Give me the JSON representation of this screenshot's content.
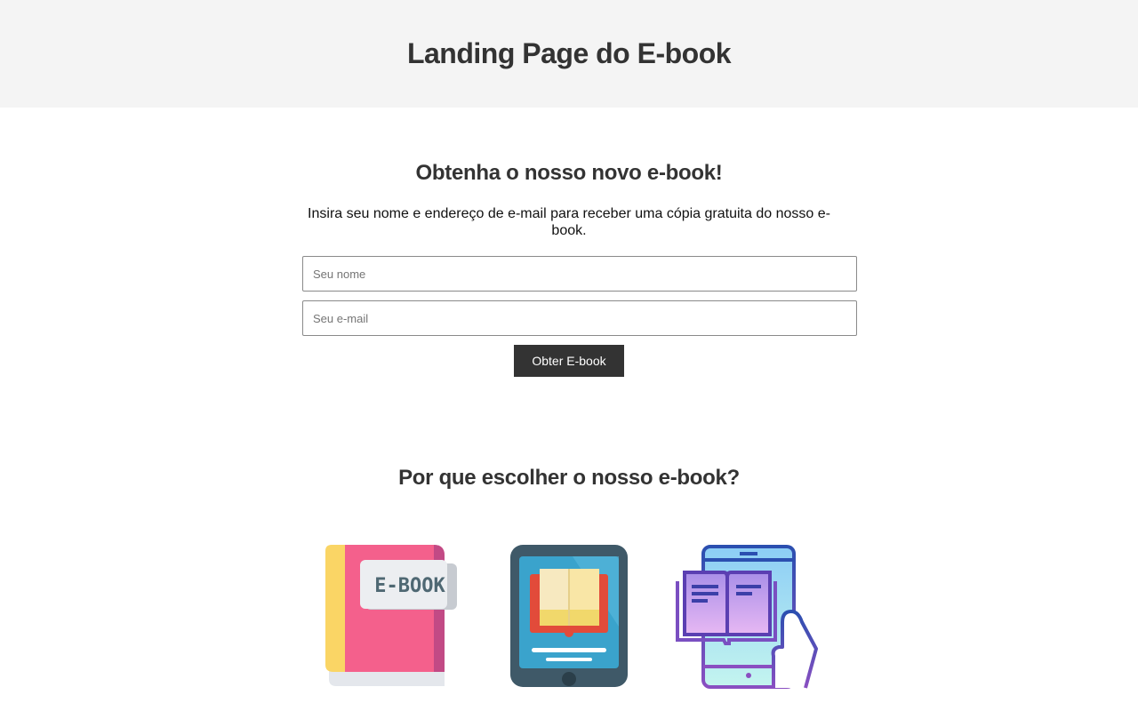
{
  "header": {
    "title": "Landing Page do E-book"
  },
  "signup": {
    "title": "Obtenha o nosso novo e-book!",
    "description": "Insira seu nome e endereço de e-mail para receber uma cópia gratuita do nosso e-book.",
    "name_placeholder": "Seu nome",
    "email_placeholder": "Seu e-mail",
    "submit_label": "Obter E-book"
  },
  "features": {
    "title": "Por que escolher o nosso e-book?",
    "items": [
      {
        "icon": "ebook-book-icon",
        "label": "E-BOOK"
      },
      {
        "icon": "ebook-reader-tablet-icon"
      },
      {
        "icon": "phone-open-book-icon"
      }
    ]
  },
  "colors": {
    "header_bg": "#f4f4f4",
    "text": "#333333",
    "button_bg": "#333333",
    "button_text": "#ffffff"
  }
}
